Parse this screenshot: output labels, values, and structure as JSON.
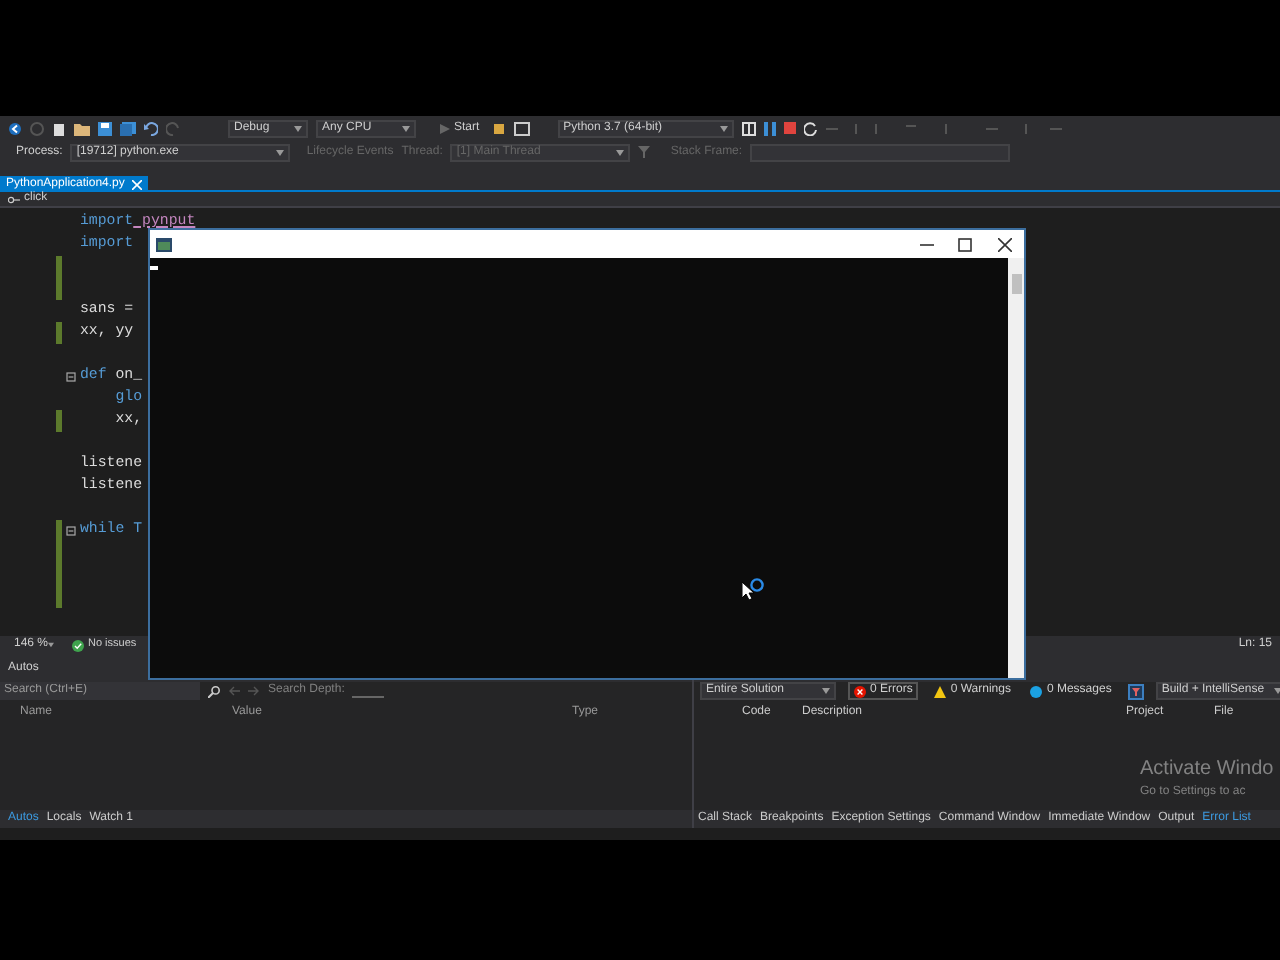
{
  "toolbar": {
    "configuration": "Debug",
    "platform": "Any CPU",
    "start": "Start",
    "environment": "Python 3.7 (64-bit)"
  },
  "debug_location": {
    "process_label": "Process:",
    "process": "[19712] python.exe",
    "lifecycle": "Lifecycle Events",
    "thread_label": "Thread:",
    "thread": "[1] Main Thread",
    "stack_frame_label": "Stack Frame:"
  },
  "tabs": [
    {
      "label": "PythonApplication4.py",
      "selected": true
    }
  ],
  "navigation": {
    "member": "click"
  },
  "code_lines": [
    {
      "tokens": [
        {
          "text": "import",
          "kind": "keyword"
        },
        {
          "text": " pynput",
          "kind": "module"
        }
      ],
      "changed": false,
      "fold": false
    },
    {
      "tokens": [
        {
          "text": "import",
          "kind": "keyword"
        }
      ],
      "changed": false,
      "fold": false
    },
    {
      "changed": true,
      "fold": false
    },
    {
      "changed": true,
      "fold": false
    },
    {
      "tokens": [
        {
          "text": "sans =",
          "kind": "plain"
        }
      ],
      "changed": false,
      "fold": false
    },
    {
      "tokens": [
        {
          "text": "xx, yy",
          "kind": "plain"
        }
      ],
      "changed": true,
      "fold": false
    },
    {
      "changed": false,
      "fold": false
    },
    {
      "tokens": [
        {
          "text": "def",
          "kind": "keyword"
        },
        {
          "text": " on_",
          "kind": "plain"
        }
      ],
      "changed": false,
      "fold": true
    },
    {
      "tokens": [
        {
          "text": "    glo",
          "kind": "keyword"
        }
      ],
      "changed": false,
      "fold": false
    },
    {
      "tokens": [
        {
          "text": "    xx,",
          "kind": "plain"
        }
      ],
      "changed": true,
      "fold": false
    },
    {
      "changed": false,
      "fold": false
    },
    {
      "tokens": [
        {
          "text": "listene",
          "kind": "plain"
        }
      ],
      "changed": false,
      "fold": false
    },
    {
      "tokens": [
        {
          "text": "listene",
          "kind": "plain"
        }
      ],
      "changed": false,
      "fold": false
    },
    {
      "changed": false,
      "fold": false
    },
    {
      "tokens": [
        {
          "text": "while T",
          "kind": "keyword"
        }
      ],
      "changed": true,
      "fold": true
    },
    {
      "changed": true,
      "fold": false
    },
    {
      "changed": true,
      "fold": false
    },
    {
      "changed": true,
      "fold": false
    }
  ],
  "editor_status": {
    "zoom": "146 %",
    "issues": "No issues",
    "position": "Ln: 15"
  },
  "autos": {
    "title": "Autos",
    "search_placeholder": "Search (Ctrl+E)",
    "search_depth": "Search Depth:",
    "columns": [
      "Name",
      "Value",
      "Type"
    ],
    "tabs": [
      {
        "label": "Autos",
        "selected": true
      },
      {
        "label": "Locals",
        "selected": false
      },
      {
        "label": "Watch 1",
        "selected": false
      }
    ]
  },
  "error_list": {
    "scope": "Entire Solution",
    "errors": "0 Errors",
    "warnings": "0 Warnings",
    "messages": "0 Messages",
    "source": "Build + IntelliSense",
    "columns": [
      "Code",
      "Description",
      "Project",
      "File"
    ],
    "tabs": [
      {
        "label": "Call Stack",
        "selected": false
      },
      {
        "label": "Breakpoints",
        "selected": false
      },
      {
        "label": "Exception Settings",
        "selected": false
      },
      {
        "label": "Command Window",
        "selected": false
      },
      {
        "label": "Immediate Window",
        "selected": false
      },
      {
        "label": "Output",
        "selected": false
      },
      {
        "label": "Error List",
        "selected": true
      }
    ]
  },
  "activation_notice": {
    "title": "Activate Windo",
    "subtitle": "Go to Settings to ac"
  }
}
